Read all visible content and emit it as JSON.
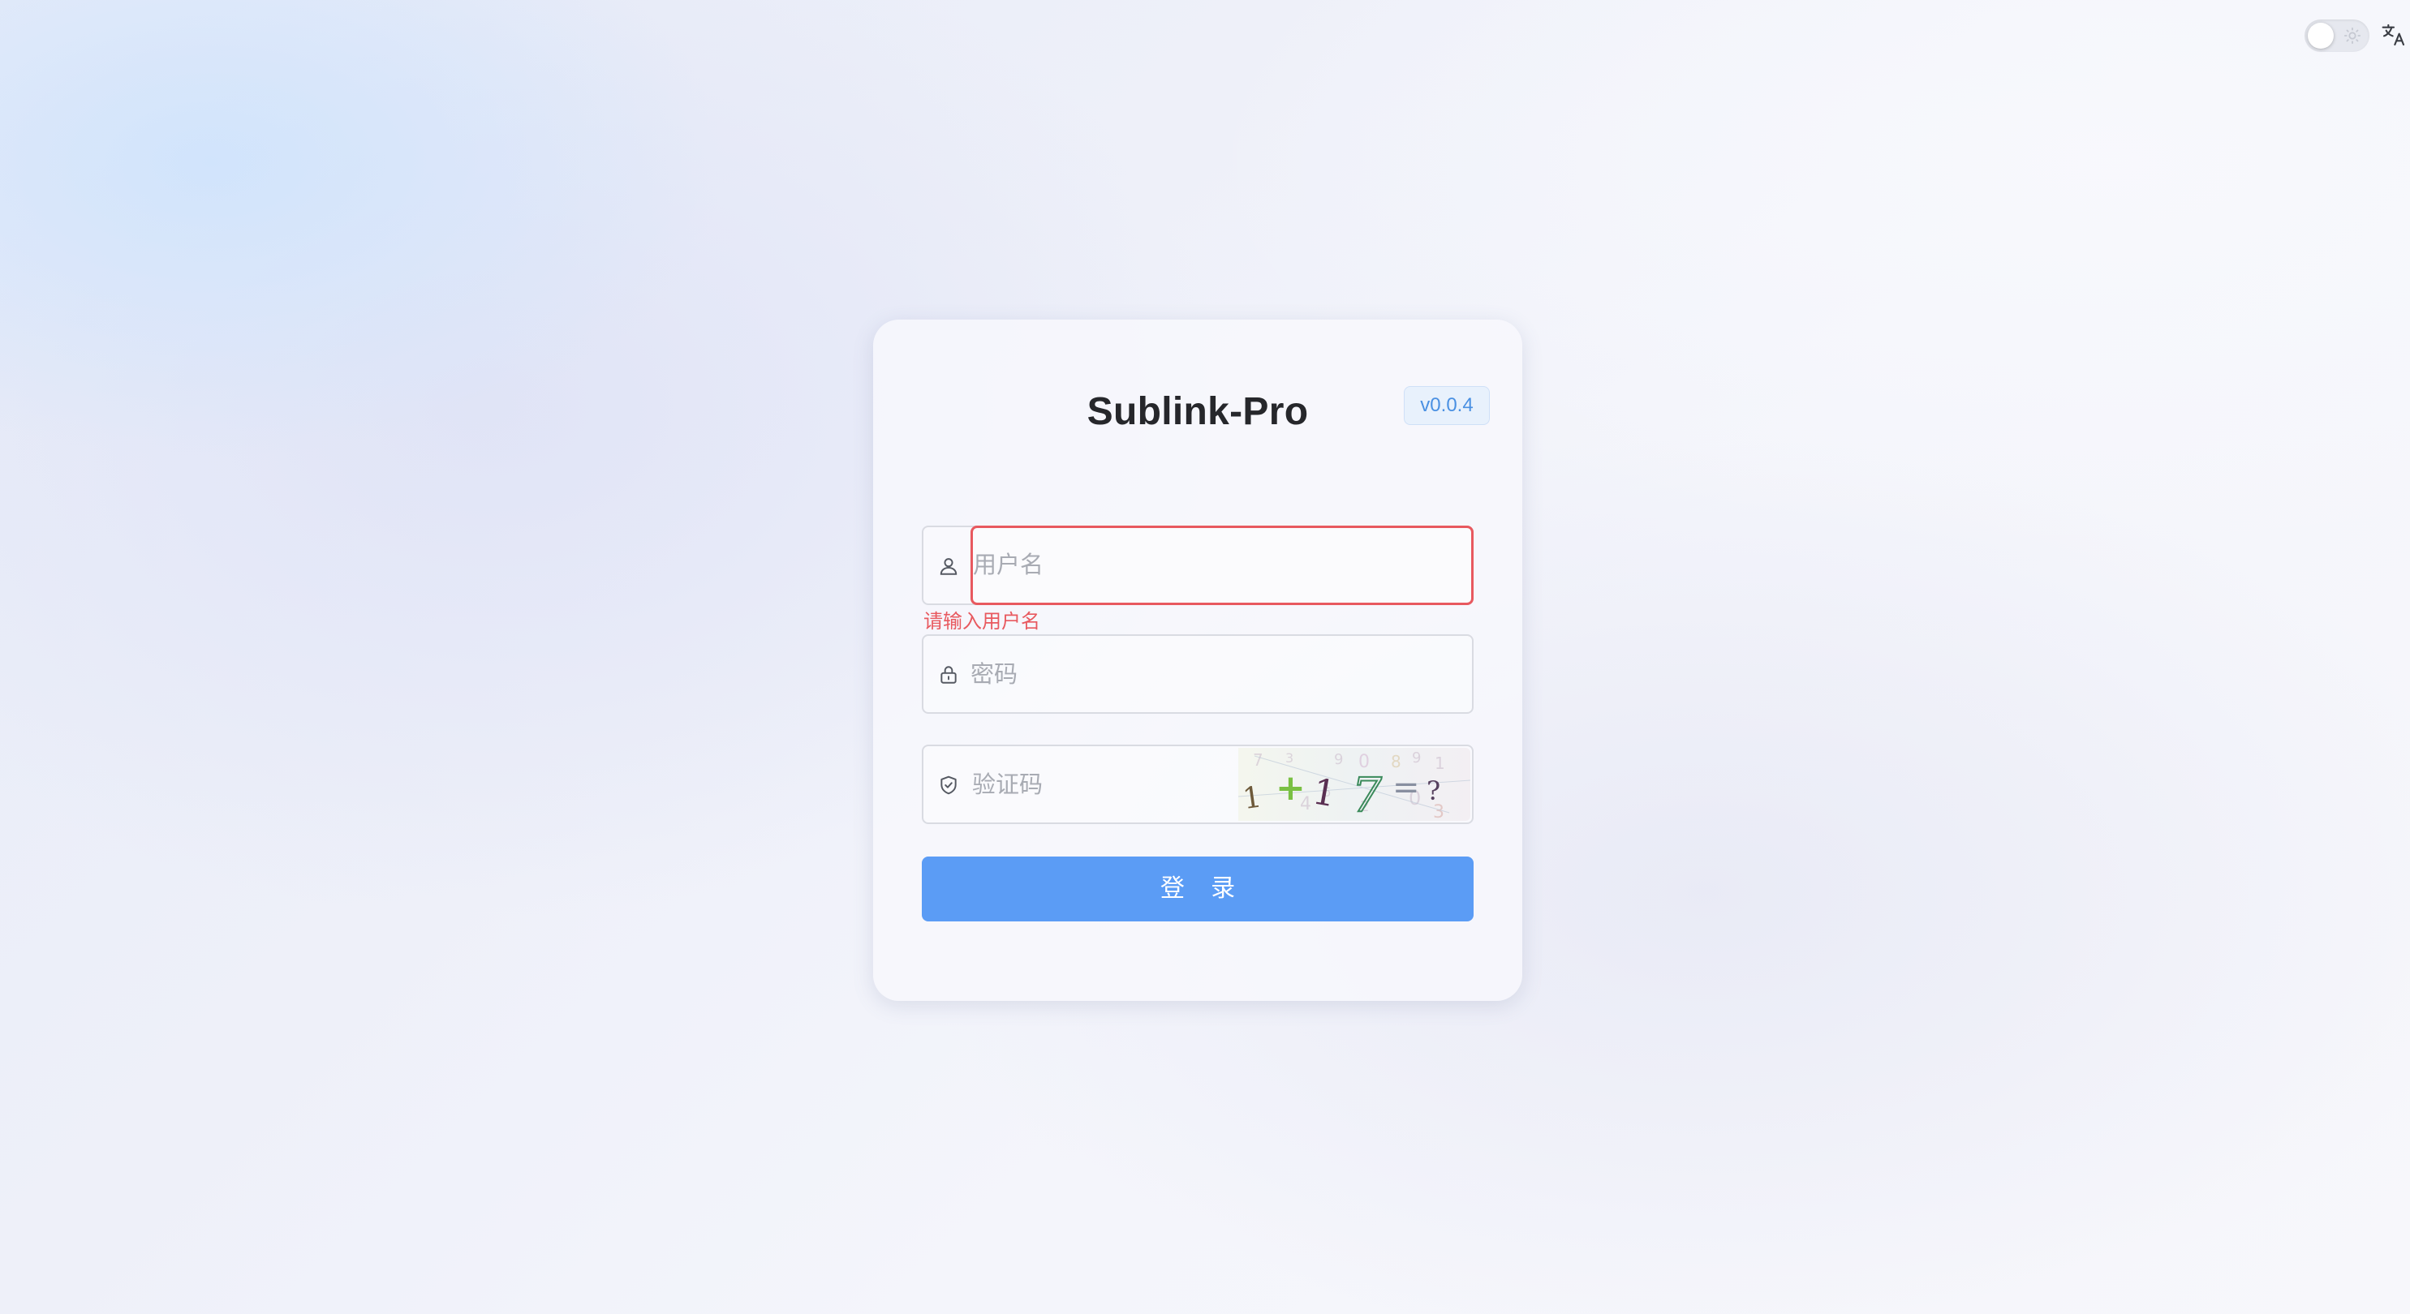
{
  "app": {
    "title": "Sublink-Pro",
    "version": "v0.0.4"
  },
  "header": {
    "theme_toggle_icon": "sun-icon",
    "language_icon": "translate-icon"
  },
  "form": {
    "username": {
      "placeholder": "用户名",
      "value": "",
      "error": "请输入用户名",
      "icon": "user-icon"
    },
    "password": {
      "placeholder": "密码",
      "value": "",
      "icon": "lock-icon"
    },
    "captcha": {
      "placeholder": "验证码",
      "value": "",
      "icon": "shield-icon",
      "image_text": "1 + 1 7 = ?"
    },
    "submit_label": "登 录"
  },
  "colors": {
    "primary": "#5b9cf5",
    "error": "#e8595f",
    "version_text": "#4a90e2",
    "version_bg": "#e8f1fc"
  }
}
